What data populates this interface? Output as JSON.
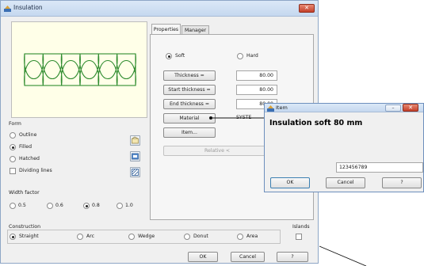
{
  "main_window": {
    "title": "Insulation",
    "close_glyph": "✕",
    "form_label": "Form",
    "form_options": [
      "Outline",
      "Filled",
      "Hatched"
    ],
    "form_selected": "Filled",
    "dividing_lines_label": "Dividing lines",
    "dividing_lines_checked": false,
    "width_factor_label": "Width factor",
    "width_factor_options": [
      "0.5",
      "0.6",
      "0.8",
      "1.0"
    ],
    "width_factor_selected": "0.8",
    "construction_label": "Construction",
    "construction_options": [
      "Straight",
      "Arc",
      "Wedge",
      "Donut",
      "Area"
    ],
    "construction_selected": "Straight",
    "islands_label": "Islands",
    "islands_checked": false,
    "ok_label": "OK",
    "cancel_label": "Cancel",
    "help_label": "?"
  },
  "tabs": [
    {
      "label": "Properties",
      "active": true
    },
    {
      "label": "Manager",
      "active": false
    }
  ],
  "properties": {
    "soft_label": "Soft",
    "hard_label": "Hard",
    "type_selected": "Soft",
    "thickness_label": "Thickness =",
    "thickness_value": "80.00",
    "start_thickness_label": "Start thickness =",
    "start_thickness_value": "80.00",
    "end_thickness_label": "End thickness =",
    "end_thickness_value": "80.00",
    "material_label": "Material",
    "material_value": "SYSTE",
    "item_label": "Item...",
    "relative_label": "Relative <"
  },
  "item_dialog": {
    "title": "Item",
    "heading": "Insulation soft 80 mm",
    "code_value": "123456789",
    "ok_label": "OK",
    "cancel_label": "Cancel",
    "help_label": "?",
    "min_glyph": "–",
    "close_glyph": "✕"
  },
  "colors": {
    "preview_background": "#ffffe8",
    "insulation_pattern": "#2e8b2e",
    "title_bar": "#c5d8ef",
    "close_button": "#c4402a"
  }
}
